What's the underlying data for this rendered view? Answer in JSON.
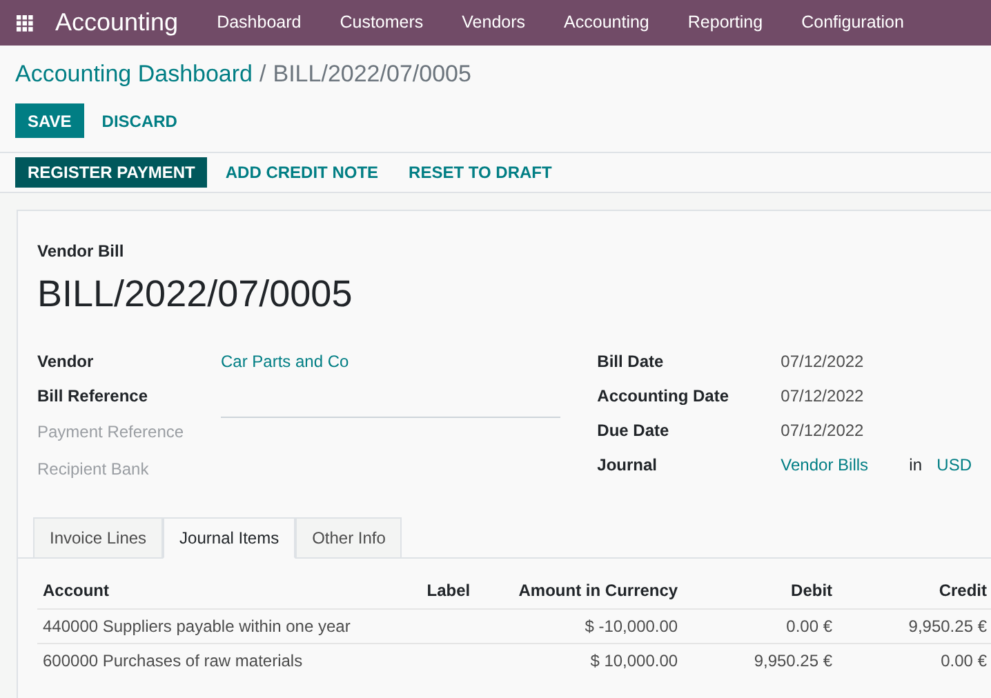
{
  "navbar": {
    "app": "Accounting",
    "menu": [
      "Dashboard",
      "Customers",
      "Vendors",
      "Accounting",
      "Reporting",
      "Configuration"
    ]
  },
  "breadcrumb": {
    "parent": "Accounting Dashboard",
    "separator": "/",
    "current": "BILL/2022/07/0005"
  },
  "form_buttons": [
    {
      "label": "SAVE",
      "kind": "primary"
    },
    {
      "label": "DISCARD",
      "kind": "link"
    }
  ],
  "action_buttons": [
    {
      "label": "REGISTER PAYMENT",
      "kind": "primary"
    },
    {
      "label": "ADD CREDIT NOTE",
      "kind": "link"
    },
    {
      "label": "RESET TO DRAFT",
      "kind": "link"
    }
  ],
  "document": {
    "type": "Vendor Bill",
    "name": "BILL/2022/07/0005"
  },
  "left_fields": [
    {
      "label": "Vendor",
      "muted": false,
      "kind": "link",
      "value": "Car Parts and Co"
    },
    {
      "label": "Bill Reference",
      "muted": false,
      "kind": "input"
    },
    {
      "label": "Payment Reference",
      "muted": true,
      "kind": "empty"
    },
    {
      "label": "Recipient Bank",
      "muted": true,
      "kind": "empty"
    }
  ],
  "right_fields": [
    {
      "label": "Bill Date",
      "kind": "text",
      "value": "07/12/2022"
    },
    {
      "label": "Accounting Date",
      "kind": "text",
      "value": "07/12/2022"
    },
    {
      "label": "Due Date",
      "kind": "text",
      "value": "07/12/2022"
    },
    {
      "label": "Journal",
      "kind": "journal",
      "value": "Vendor Bills",
      "connector": "in",
      "currency": "USD"
    }
  ],
  "tabs": [
    {
      "label": "Invoice Lines",
      "selected": false
    },
    {
      "label": "Journal Items",
      "selected": true
    },
    {
      "label": "Other Info",
      "selected": false
    }
  ],
  "table": {
    "columns": [
      "Account",
      "Label",
      "Amount in Currency",
      "Debit",
      "Credit"
    ],
    "rows": [
      [
        "440000 Suppliers payable within one year",
        "",
        "$ -10,000.00",
        "0.00 €",
        "9,950.25 €"
      ],
      [
        "600000 Purchases of raw materials",
        "",
        "$ 10,000.00",
        "9,950.25 €",
        "0.00 €"
      ]
    ]
  }
}
